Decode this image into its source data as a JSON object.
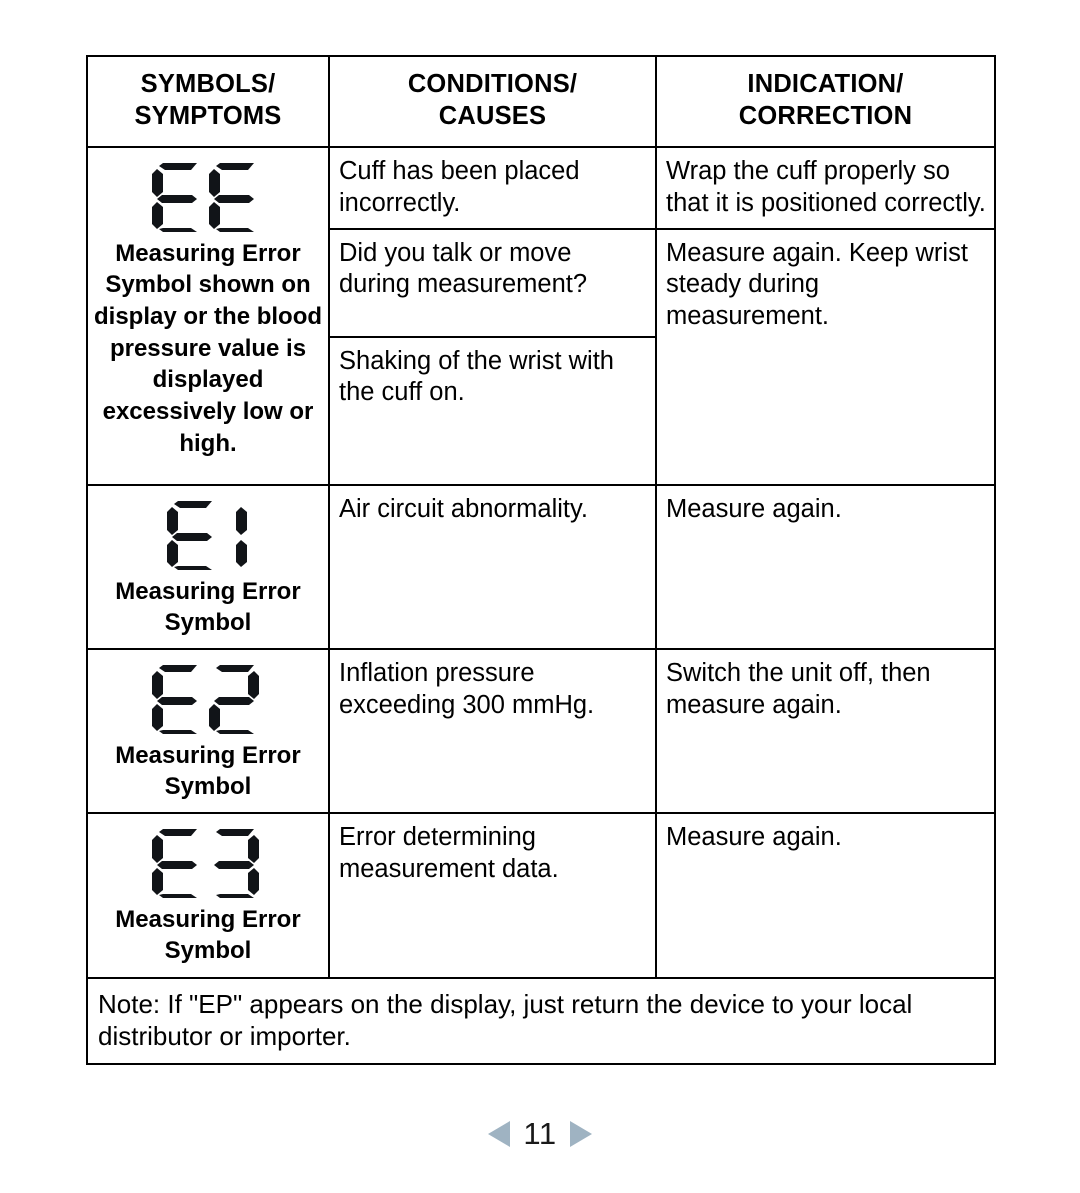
{
  "document": {
    "page_number": "11",
    "prev_arrow_icon": "triangle-left-icon",
    "next_arrow_icon": "triangle-right-icon",
    "arrow_color": "#9fb3c2"
  },
  "table": {
    "headers": [
      "SYMBOLS/\nSYMPTOMS",
      "CONDITIONS/\nCAUSES",
      "INDICATION/\nCORRECTION"
    ],
    "header_lines": {
      "col1_line1": "SYMBOLS/",
      "col1_line2": "SYMPTOMS",
      "col2_line1": "CONDITIONS/",
      "col2_line2": "CAUSES",
      "col3_line1": "INDICATION/",
      "col3_line2": "CORRECTION"
    },
    "rows": [
      {
        "symbol_code": "EE",
        "symbol_caption": "Measuring Error Symbol shown on display or the blood pressure value is displayed excessively low or high.",
        "sub_rows": [
          {
            "cause": "Cuff has been placed incorrectly.",
            "correction": "Wrap the cuff properly so that it is positioned correctly."
          },
          {
            "cause": "Did you talk or move during measurement?",
            "cause_2": "Shaking of the wrist with the cuff on.",
            "correction": "Measure again. Keep wrist steady during measurement."
          }
        ]
      },
      {
        "symbol_code": "E1",
        "symbol_caption": "Measuring Error Symbol",
        "cause": "Air circuit abnormality.",
        "correction": "Measure again."
      },
      {
        "symbol_code": "E2",
        "symbol_caption": "Measuring Error Symbol",
        "cause": "Inflation pressure exceeding 300 mmHg.",
        "correction": "Switch the unit off, then measure again."
      },
      {
        "symbol_code": "E3",
        "symbol_caption": "Measuring Error Symbol",
        "cause": "Error determining measurement data.",
        "correction": "Measure again."
      }
    ],
    "note": "Note: If \"EP\" appears on the display, just return the device to your local distributor or importer."
  }
}
